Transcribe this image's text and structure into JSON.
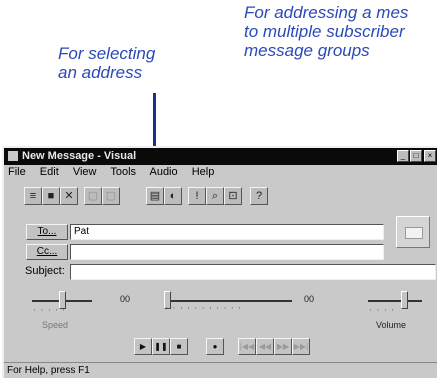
{
  "callouts": {
    "select_address": "For selecting\nan address",
    "multiple_subscribers": "For addressing a mes\nto multiple subscriber\nmessage groups"
  },
  "window": {
    "title": "New Message - Visual",
    "controls": [
      "_",
      "□",
      "×"
    ]
  },
  "menu": [
    "File",
    "Edit",
    "View",
    "Tools",
    "Audio",
    "Help"
  ],
  "toolbar": {
    "icons": [
      "doc-icon",
      "save-icon",
      "delete-icon",
      "cut-icon",
      "copy-icon",
      "address-book-icon",
      "group-icon",
      "priority-icon",
      "find-icon",
      "options-icon",
      "help-icon"
    ],
    "glyphs": [
      "≡",
      "■",
      "✕",
      "▢",
      "▢",
      "▤",
      "◐",
      "!",
      "⌕",
      "⊡",
      "?"
    ]
  },
  "fields": {
    "to_button": "To...",
    "to_value": "Pat",
    "cc_button": "Cc...",
    "cc_value": "",
    "subject_label": "Subject:",
    "subject_value": ""
  },
  "audio": {
    "speed_label": "Speed",
    "volume_label": "Volume",
    "position_start": "00",
    "position_end": "00",
    "speed_level": 0.5,
    "position_level": 0.0,
    "volume_level": 0.7,
    "controls": [
      "▶",
      "❚❚",
      "■",
      "●",
      "|◀◀",
      "◀◀",
      "▶▶",
      "▶▶|"
    ]
  },
  "status": "For Help, press F1",
  "colors": {
    "callout": "#2b49b8",
    "pointer": "#1f2f85",
    "titlebar": "#0a0a0a",
    "window_face": "#c9c9c9"
  }
}
